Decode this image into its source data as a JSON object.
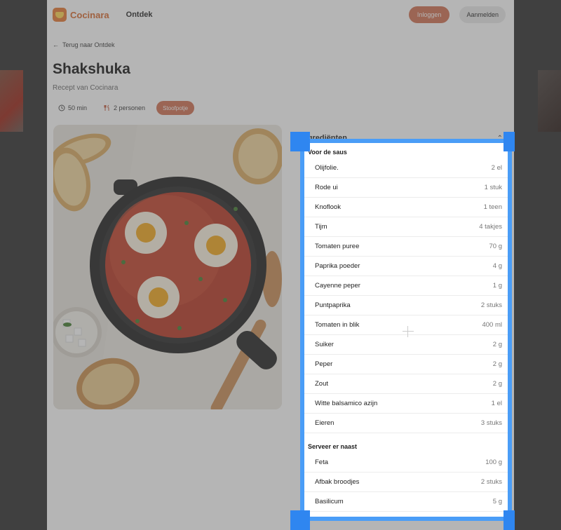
{
  "header": {
    "brand": "Cocinara",
    "nav_ontdek": "Ontdek",
    "login": "Inloggen",
    "signup": "Aanmelden"
  },
  "back_link": "Terug naar Ontdek",
  "recipe": {
    "title": "Shakshuka",
    "subtitle": "Recept van Cocinara",
    "time": "50 min",
    "servings": "2 personen",
    "tag": "Stoofpotje"
  },
  "ingredients": {
    "heading": "Ingrediënten",
    "sections": [
      {
        "title": "Voor de saus",
        "items": [
          {
            "name": "Olijfolie.",
            "qty": "2 el"
          },
          {
            "name": "Rode ui",
            "qty": "1 stuk"
          },
          {
            "name": "Knoflook",
            "qty": "1 teen"
          },
          {
            "name": "Tijm",
            "qty": "4 takjes"
          },
          {
            "name": "Tomaten puree",
            "qty": "70 g"
          },
          {
            "name": "Paprika poeder",
            "qty": "4 g"
          },
          {
            "name": "Cayenne peper",
            "qty": "1 g"
          },
          {
            "name": "Puntpaprika",
            "qty": "2 stuks"
          },
          {
            "name": "Tomaten in blik",
            "qty": "400 ml"
          },
          {
            "name": "Suiker",
            "qty": "2 g"
          },
          {
            "name": "Peper",
            "qty": "2 g"
          },
          {
            "name": "Zout",
            "qty": "2 g"
          },
          {
            "name": "Witte balsamico azijn",
            "qty": "1 el"
          },
          {
            "name": "Eieren",
            "qty": "3 stuks"
          }
        ]
      },
      {
        "title": "Serveer er naast",
        "items": [
          {
            "name": "Feta",
            "qty": "100 g"
          },
          {
            "name": "Afbak broodjes",
            "qty": "2 stuks"
          },
          {
            "name": "Basilicum",
            "qty": "5 g"
          }
        ]
      }
    ]
  },
  "colors": {
    "accent": "#cf6e4f",
    "brand": "#d8672a",
    "selection": "#4a9df7"
  }
}
